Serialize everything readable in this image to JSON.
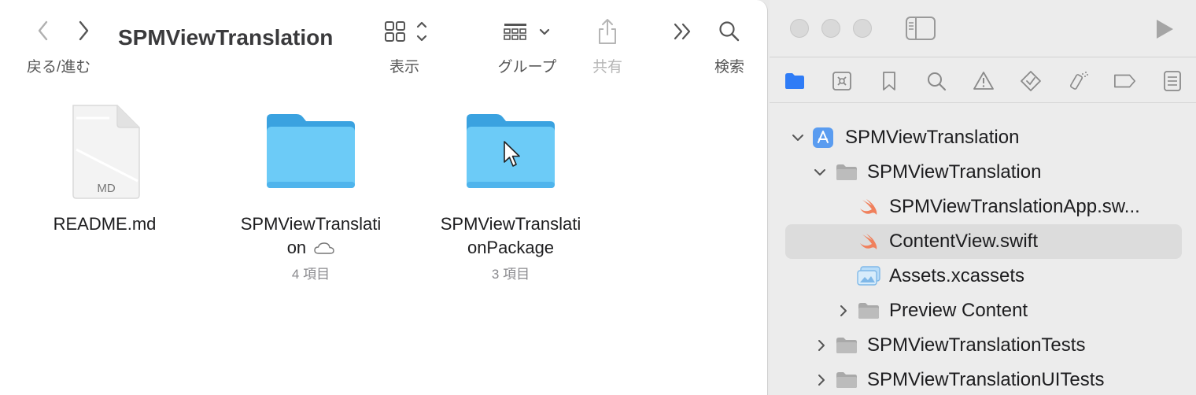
{
  "finder": {
    "title": "SPMViewTranslation",
    "nav_label": "戻る/進む",
    "toolbar": {
      "view_label": "表示",
      "group_label": "グループ",
      "share_label": "共有",
      "search_label": "検索"
    },
    "items": [
      {
        "name": "README.md",
        "badge": "MD",
        "meta": ""
      },
      {
        "name_line1": "SPMViewTranslati",
        "name_line2": "on",
        "meta": "4 項目",
        "icloud_icon": "cloud-icon"
      },
      {
        "name_line1": "SPMViewTranslati",
        "name_line2": "onPackage",
        "meta": "3 項目"
      }
    ],
    "colors": {
      "folder": "#5fbff5",
      "folder_tab": "#3aa2e0"
    }
  },
  "xcode": {
    "nav_tabs": [
      "folder-icon",
      "source-control-icon",
      "bookmark-icon",
      "find-icon",
      "issue-icon",
      "test-icon",
      "debug-icon",
      "breakpoint-icon",
      "report-icon"
    ],
    "tree": [
      {
        "label": "SPMViewTranslation",
        "level": 0,
        "expanded": true,
        "icon": "app-icon"
      },
      {
        "label": "SPMViewTranslation",
        "level": 1,
        "expanded": true,
        "icon": "group-folder-icon"
      },
      {
        "label": "SPMViewTranslationApp.sw...",
        "level": 2,
        "icon": "swift-icon"
      },
      {
        "label": "ContentView.swift",
        "level": 2,
        "icon": "swift-icon",
        "selected": true
      },
      {
        "label": "Assets.xcassets",
        "level": 2,
        "icon": "assets-icon"
      },
      {
        "label": "Preview Content",
        "level": 2,
        "expanded": false,
        "icon": "group-folder-icon"
      },
      {
        "label": "SPMViewTranslationTests",
        "level": 1,
        "expanded": false,
        "icon": "group-folder-icon"
      },
      {
        "label": "SPMViewTranslationUITests",
        "level": 1,
        "expanded": false,
        "icon": "group-folder-icon"
      }
    ],
    "colors": {
      "accent": "#2f7cf6",
      "swift": "#f0805c"
    }
  }
}
